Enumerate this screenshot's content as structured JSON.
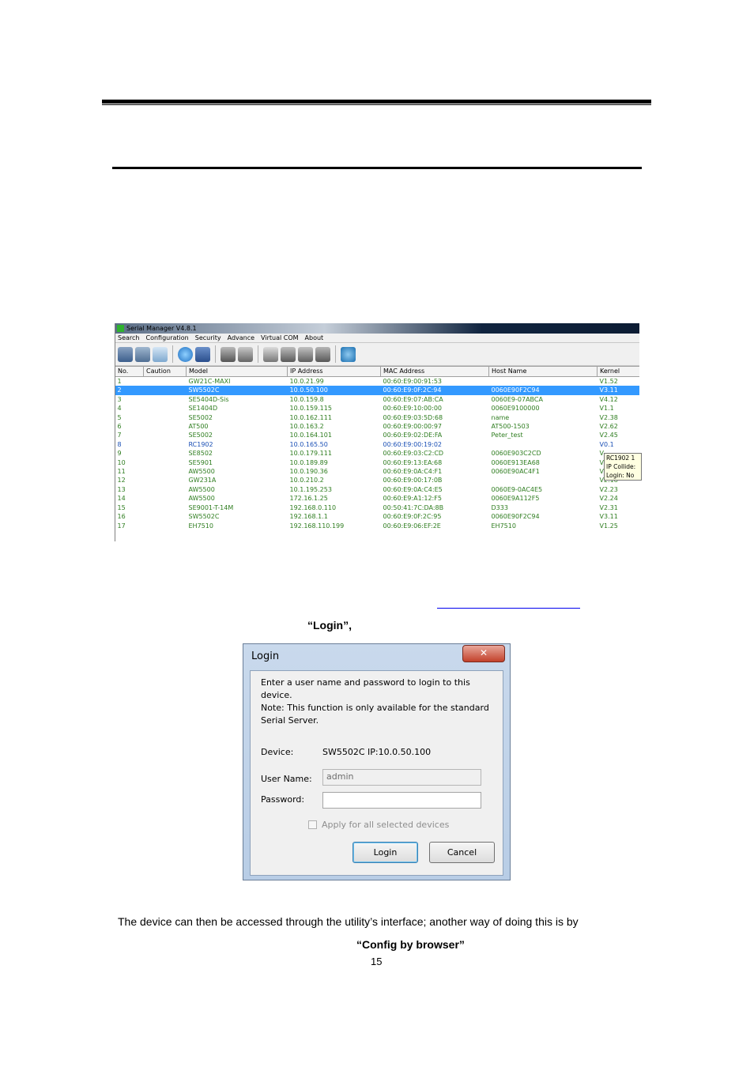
{
  "serial_manager": {
    "title": "Serial Manager V4.8.1",
    "menu": [
      "Search",
      "Configuration",
      "Security",
      "Advance",
      "Virtual COM",
      "About"
    ],
    "columns": [
      "No.",
      "Caution",
      "Model",
      "IP Address",
      "MAC Address",
      "Host Name",
      "Kernel"
    ],
    "rows": [
      [
        "1",
        "",
        "GW21C-MAXI",
        "10.0.21.99",
        "00:60:E9:00:91:53",
        "",
        "V1.52"
      ],
      [
        "2",
        "",
        "SW5502C",
        "10.0.50.100",
        "00:60:E9:0F:2C:94",
        "0060E90F2C94",
        "V3.11"
      ],
      [
        "3",
        "",
        "SE5404D-Sis",
        "10.0.159.8",
        "00:60:E9:07:AB:CA",
        "0060E9-07ABCA",
        "V4.12"
      ],
      [
        "4",
        "",
        "SE1404D",
        "10.0.159.115",
        "00:60:E9:10:00:00",
        "0060E9100000",
        "V1.1"
      ],
      [
        "5",
        "",
        "SE5002",
        "10.0.162.111",
        "00:60:E9:03:5D:68",
        "name",
        "V2.38"
      ],
      [
        "6",
        "",
        "AT500",
        "10.0.163.2",
        "00:60:E9:00:00:97",
        "AT500-1503",
        "V2.62"
      ],
      [
        "7",
        "",
        "SE5002",
        "10.0.164.101",
        "00:60:E9:02:DE:FA",
        "Peter_test",
        "V2.45"
      ],
      [
        "8",
        "",
        "RC1902",
        "10.0.165.50",
        "00:60:E9:00:19:02",
        "",
        "V0.1"
      ],
      [
        "9",
        "",
        "SE8502",
        "10.0.179.111",
        "00:60:E9:03:C2:CD",
        "0060E903C2CD",
        "V"
      ],
      [
        "10",
        "",
        "SE5901",
        "10.0.189.89",
        "00:60:E9:13:EA:68",
        "0060E913EA68",
        "V"
      ],
      [
        "11",
        "",
        "AW5500",
        "10.0.190.36",
        "00:60:E9:0A:C4:F1",
        "0060E90AC4F1",
        "V"
      ],
      [
        "12",
        "",
        "GW231A",
        "10.0.210.2",
        "00:60:E9:00:17:0B",
        "",
        "V2.18"
      ],
      [
        "13",
        "",
        "AW5500",
        "10.1.195.253",
        "00:60:E9:0A:C4:E5",
        "0060E9-0AC4E5",
        "V2.23"
      ],
      [
        "14",
        "",
        "AW5500",
        "172.16.1.25",
        "00:60:E9:A1:12:F5",
        "0060E9A112F5",
        "V2.24"
      ],
      [
        "15",
        "",
        "SE9001-T-14M",
        "192.168.0.110",
        "00:50:41:7C:DA:8B",
        "D333",
        "V2.31"
      ],
      [
        "16",
        "",
        "SW5502C",
        "192.168.1.1",
        "00:60:E9:0F:2C:95",
        "0060E90F2C94",
        "V3.11"
      ],
      [
        "17",
        "",
        "EH7510",
        "192.168.110.199",
        "00:60:E9:06:EF:2E",
        "EH7510",
        "V1.25"
      ]
    ],
    "tooltip": [
      "RC1902  1",
      "IP Collide:",
      "Login:  No"
    ]
  },
  "doc": {
    "login_word": "“Login”,",
    "body_text": "The device can then be accessed through the utility’s interface; another way of doing this is by",
    "config_word": "“Config by browser”",
    "page_number": "15"
  },
  "login_dialog": {
    "title": "Login",
    "close_glyph": "✕",
    "message": "Enter a user name and password to login to this device.\nNote: This function is only available for the standard Serial Server.",
    "device_label": "Device:",
    "device_value": "SW5502C   IP:10.0.50.100",
    "username_label": "User Name:",
    "username_value": "admin",
    "password_label": "Password:",
    "password_value": "",
    "apply_all_label": "Apply for all selected devices",
    "login_button": "Login",
    "cancel_button": "Cancel"
  }
}
